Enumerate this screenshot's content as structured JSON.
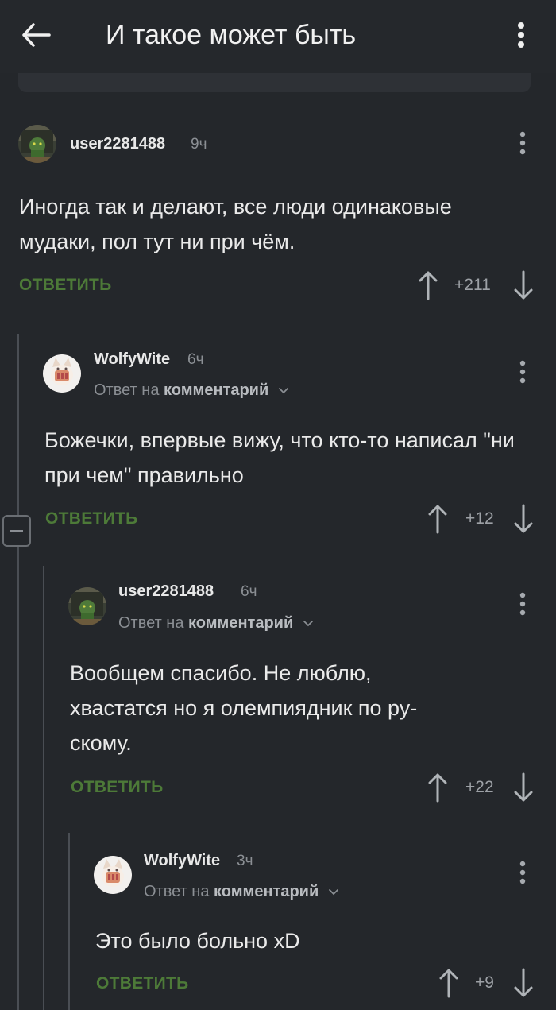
{
  "header": {
    "title": "И такое может быть",
    "back_icon": "arrow-left-icon",
    "menu_icon": "kebab-menu-icon"
  },
  "theme": {
    "background": "#24272b",
    "accent_green": "#4d7a38",
    "muted_text": "#8b8f94"
  },
  "comments": [
    {
      "username": "user2281488",
      "time": "9ч",
      "text": "Иногда так и делают, все люди одинаковые мудаки, пол тут ни при чём.",
      "reply_label": "ОТВЕТИТЬ",
      "score": "+211",
      "avatar": "orc-avatar"
    },
    {
      "username": "WolfyWite",
      "time": "6ч",
      "reply_to_prefix": "Ответ на",
      "reply_to_target": "комментарий",
      "text": "Божечки, впервые вижу, что кто-то написал \"ни при чем\" правильно",
      "reply_label": "ОТВЕТИТЬ",
      "score": "+12",
      "avatar": "cat-avatar"
    },
    {
      "username": "user2281488",
      "time": "6ч",
      "reply_to_prefix": "Ответ на",
      "reply_to_target": "комментарий",
      "text": "Вообщем спасибо. Не люблю, хвастатся но я олемпиядник по ру­скому.",
      "reply_label": "ОТВЕТИТЬ",
      "score": "+22",
      "avatar": "orc-avatar"
    },
    {
      "username": "WolfyWite",
      "time": "3ч",
      "reply_to_prefix": "Ответ на",
      "reply_to_target": "комментарий",
      "text": "Это было больно xD",
      "reply_label": "ОТВЕТИТЬ",
      "score": "+9",
      "avatar": "cat-avatar"
    }
  ]
}
